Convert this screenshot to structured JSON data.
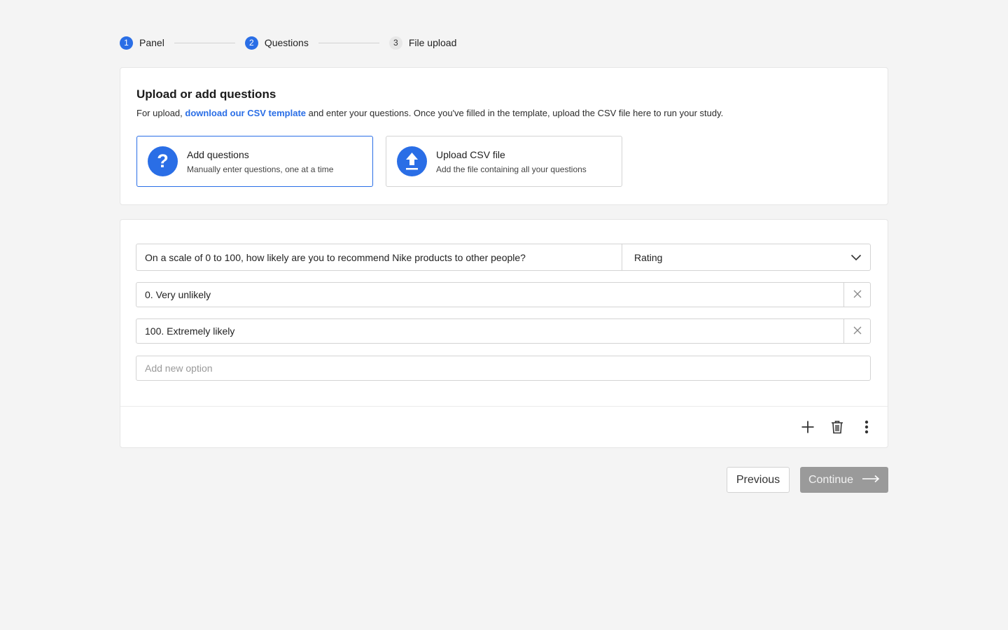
{
  "stepper": {
    "steps": [
      {
        "number": "1",
        "label": "Panel"
      },
      {
        "number": "2",
        "label": "Questions"
      },
      {
        "number": "3",
        "label": "File upload"
      }
    ]
  },
  "upload_card": {
    "heading": "Upload or add questions",
    "desc_prefix": "For upload, ",
    "desc_link": "download our CSV template",
    "desc_suffix": " and enter your questions. Once you've filled in the template, upload the CSV file here to run your study.",
    "options": [
      {
        "title": "Add questions",
        "subtitle": "Manually enter questions, one at a time",
        "icon": "question-icon",
        "selected": true
      },
      {
        "title": "Upload CSV file",
        "subtitle": "Add the file containing all your questions",
        "icon": "upload-icon",
        "selected": false
      }
    ]
  },
  "question_card": {
    "question_text": "On a scale of 0 to 100, how likely are you to recommend Nike products to other people?",
    "question_type": "Rating",
    "answer_options": [
      "0. Very unlikely",
      "100. Extremely likely"
    ],
    "new_option_placeholder": "Add new option",
    "toolbar_icons": [
      "plus-icon",
      "trash-icon",
      "more-vertical-icon"
    ]
  },
  "footer": {
    "previous_label": "Previous",
    "continue_label": "Continue"
  },
  "colors": {
    "accent": "#2a6ee6",
    "disabled_button": "#9a9a9a",
    "background": "#f4f4f4"
  }
}
